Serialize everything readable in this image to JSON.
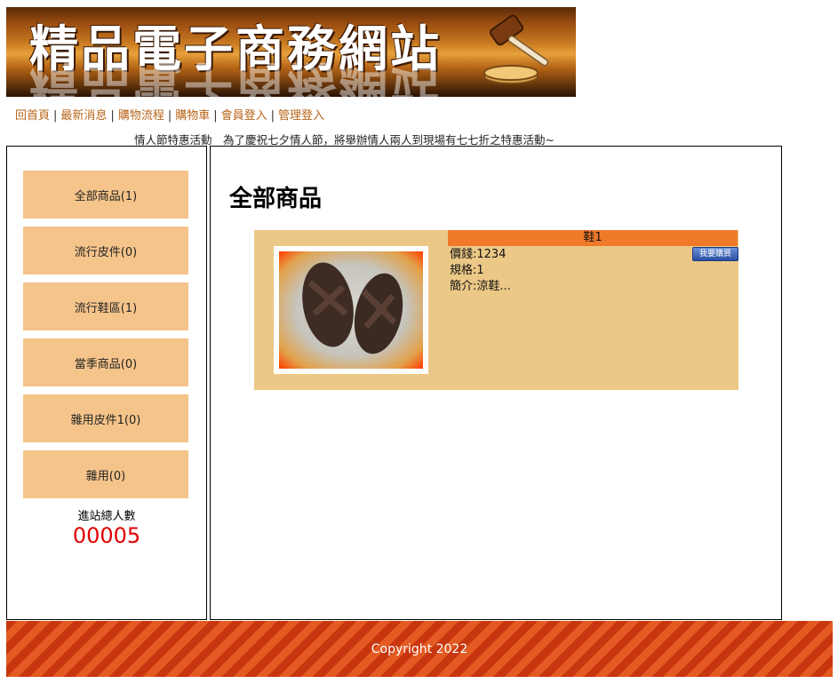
{
  "banner": {
    "title": "精品電子商務網站"
  },
  "nav": {
    "items": [
      "回首頁",
      "最新消息",
      "購物流程",
      "購物車",
      "會員登入",
      "管理登入"
    ],
    "separator": "|"
  },
  "announcement": "情人節特惠活動　為了慶祝七夕情人節，將舉辦情人兩人到現場有七七折之特惠活動~",
  "sidebar": {
    "categories": [
      "全部商品(1)",
      "流行皮件(0)",
      "流行鞋區(1)",
      "當季商品(0)",
      "雜用皮件1(0)",
      "雜用(0)"
    ],
    "counter_label": "進站總人數",
    "counter_value": "00005"
  },
  "main": {
    "heading": "全部商品",
    "product": {
      "name": "鞋1",
      "price": "價錢:1234",
      "spec": "規格:1",
      "intro": "簡介:涼鞋...",
      "buy_label": "我要購買"
    }
  },
  "footer": {
    "copyright": "Copyright 2022"
  },
  "colors": {
    "accent": "#f5c48a",
    "product_bg": "#ecc886",
    "product_name_bg": "#f07a2a",
    "counter": "#e00000",
    "nav_link": "#b8651a"
  }
}
